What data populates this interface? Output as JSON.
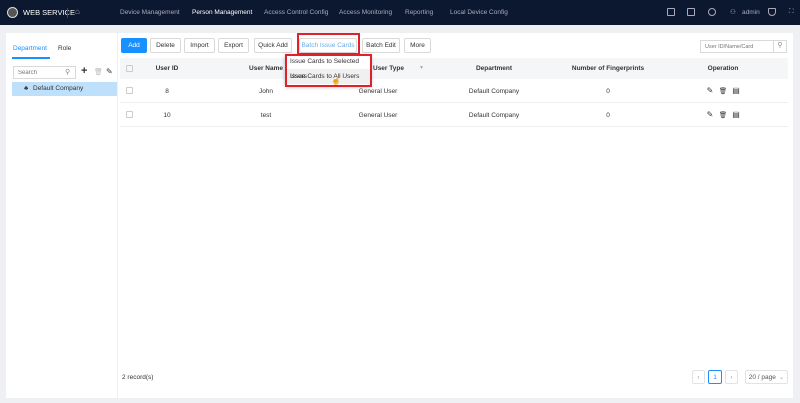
{
  "header": {
    "brand": "WEB SERVICE",
    "nav": [
      "Device Management",
      "Person Management",
      "Access Control Config",
      "Access Monitoring",
      "Reporting",
      "Local Device Config"
    ],
    "active": "Person Management",
    "user": "admin"
  },
  "left": {
    "tabs": [
      "Department",
      "Role"
    ],
    "search_placeholder": "Search",
    "tree": [
      "Default Company"
    ]
  },
  "toolbar": {
    "buttons": [
      "Add",
      "Delete",
      "Import",
      "Export",
      "Quick Add",
      "Batch Issue Cards",
      "Batch Edit",
      "More"
    ],
    "search_placeholder": "User ID/Name/Card"
  },
  "dropdown": [
    "Issue Cards to Selected Users",
    "Issue Cards to All Users"
  ],
  "table": {
    "columns": [
      "User ID",
      "User Name",
      "User Type",
      "Department",
      "Number of Fingerprints",
      "Operation"
    ],
    "type_header_visible": "r Type",
    "rows": [
      {
        "id": "8",
        "name": "John",
        "type": "General User",
        "dept": "Default Company",
        "fp": "0"
      },
      {
        "id": "10",
        "name": "test",
        "type": "General User",
        "dept": "Default Company",
        "fp": "0"
      }
    ]
  },
  "footer": {
    "records": "2 record(s)",
    "page": "1",
    "page_size": "20 / page"
  },
  "colors": {
    "accent": "#1890ff",
    "highlight": "#e0202a",
    "header_bg": "#0c1830"
  }
}
